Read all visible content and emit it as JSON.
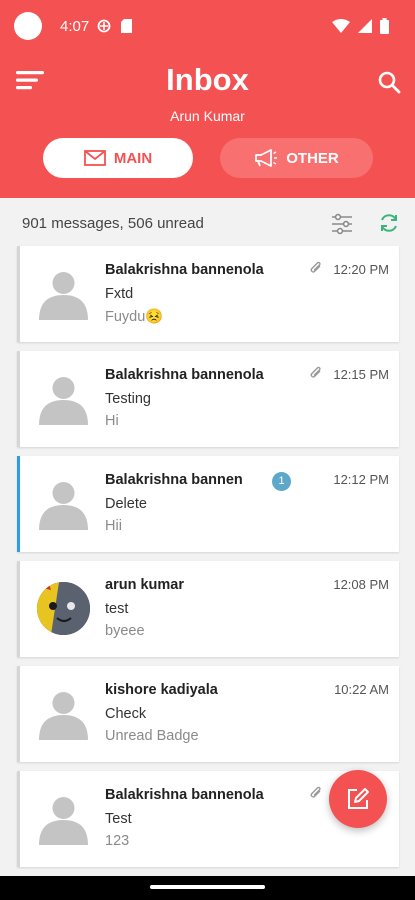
{
  "status": {
    "time": "4:07"
  },
  "header": {
    "title": "Inbox",
    "subtitle": "Arun Kumar"
  },
  "tabs": [
    {
      "label": "MAIN",
      "icon": "mail-icon",
      "selected": true
    },
    {
      "label": "OTHER",
      "icon": "megaphone-icon",
      "selected": false
    }
  ],
  "summary": "901 messages, 506 unread",
  "messages": [
    {
      "sender": "Balakrishna bannenola",
      "subject": "Fxtd",
      "preview": "Fuydu😣",
      "time": "12:20 PM",
      "attachment": true
    },
    {
      "sender": "Balakrishna bannenola",
      "subject": "Testing",
      "preview": "Hi",
      "time": "12:15 PM",
      "attachment": true
    },
    {
      "sender": "Balakrishna bannen",
      "subject": "Delete",
      "preview": "Hii",
      "time": "12:12 PM",
      "badge": "1"
    },
    {
      "sender": "arun kumar",
      "subject": "test",
      "preview": "byeee",
      "time": "12:08 PM"
    },
    {
      "sender": "kishore kadiyala",
      "subject": "Check",
      "preview": "Unread Badge",
      "time": "10:22 AM"
    },
    {
      "sender": "Balakrishna bannenola",
      "subject": "Test",
      "preview": "123",
      "time": "",
      "attachment": true
    }
  ],
  "colors": {
    "accent": "#f45252",
    "selected_border": "#2d9fe0",
    "badge": "#5da8c8",
    "refresh": "#3ab57a"
  }
}
